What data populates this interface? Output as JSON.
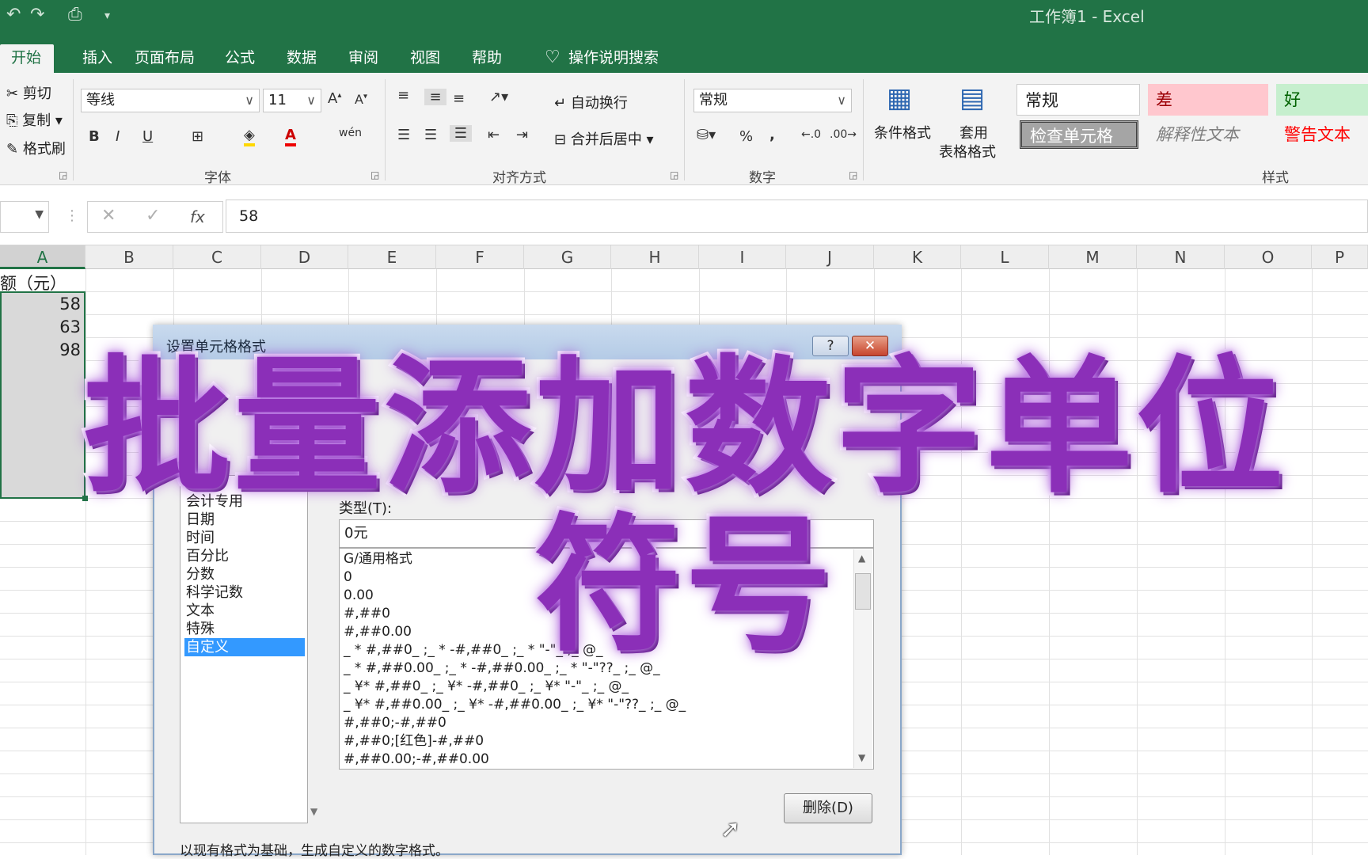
{
  "window": {
    "title": "工作簿1  -  Excel"
  },
  "tabs": [
    "开始",
    "插入",
    "页面布局",
    "公式",
    "数据",
    "审阅",
    "视图",
    "帮助"
  ],
  "tell_me": "操作说明搜索",
  "clipboard": {
    "cut": "剪切",
    "copy": "复制",
    "format_painter": "格式刷"
  },
  "font": {
    "name": "等线",
    "size": "11",
    "group_label": "字体"
  },
  "alignment": {
    "wrap_text": "自动换行",
    "merge_center": "合并后居中",
    "group_label": "对齐方式"
  },
  "number": {
    "format": "常规",
    "group_label": "数字"
  },
  "styles": {
    "conditional_format": "条件格式",
    "table_format_line1": "套用",
    "table_format_line2": "表格格式",
    "normal": "常规",
    "bad": "差",
    "good": "好",
    "check_cell": "检查单元格",
    "explanatory": "解释性文本",
    "warning": "警告文本",
    "group_label": "样式"
  },
  "formula_bar": {
    "value": "58",
    "fx": "fx"
  },
  "columns": [
    "A",
    "B",
    "C",
    "D",
    "E",
    "F",
    "G",
    "H",
    "I",
    "J",
    "K",
    "L",
    "M",
    "N",
    "O",
    "P"
  ],
  "cells": {
    "a1": "额（元）",
    "a2": "58",
    "a3": "63",
    "a4": "98"
  },
  "dialog": {
    "title": "设置单元格格式",
    "help": "?",
    "close": "✕",
    "categories": [
      "会计专用",
      "日期",
      "时间",
      "百分比",
      "分数",
      "科学记数",
      "文本",
      "特殊",
      "自定义"
    ],
    "type_label": "类型(T):",
    "type_value": "0元",
    "formats": [
      "G/通用格式",
      "0",
      "0.00",
      "#,##0",
      "#,##0.00",
      "_ * #,##0_ ;_ * -#,##0_ ;_ * \"-\"_ ;_ @_",
      "_ * #,##0.00_ ;_ * -#,##0.00_ ;_ * \"-\"??_ ;_ @_",
      "_ ¥* #,##0_ ;_ ¥* -#,##0_ ;_ ¥* \"-\"_ ;_ @_",
      "_ ¥* #,##0.00_ ;_ ¥* -#,##0.00_ ;_ ¥* \"-\"??_ ;_ @_",
      "#,##0;-#,##0",
      "#,##0;[红色]-#,##0",
      "#,##0.00;-#,##0.00"
    ],
    "delete_button": "删除(D)",
    "hint": "以现有格式为基础，生成自定义的数字格式。"
  },
  "overlay_caption": "批量添加数字单位符号",
  "colors": {
    "excel_green": "#217346",
    "selection_blue": "#3399ff",
    "overlay_purple": "#8b2fb8"
  }
}
